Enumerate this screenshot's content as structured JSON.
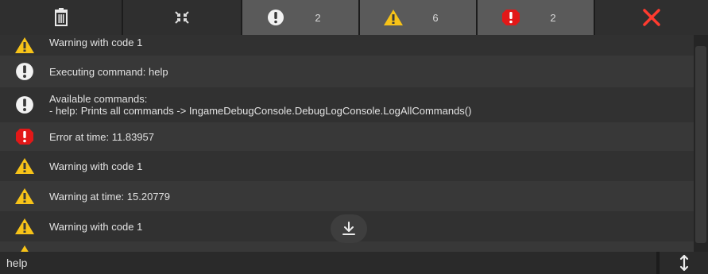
{
  "toolbar": {
    "clear_icon": "trash-icon",
    "collapse_icon": "collapse-icon",
    "filters": [
      {
        "type": "info",
        "icon": "info-icon",
        "count": "2"
      },
      {
        "type": "warning",
        "icon": "warning-icon",
        "count": "6"
      },
      {
        "type": "error",
        "icon": "error-icon",
        "count": "2"
      }
    ],
    "close_icon": "close-icon",
    "colors": {
      "info": "#f2f2f2",
      "warning": "#f7c318",
      "error": "#e21818",
      "close": "#ff3b2f"
    }
  },
  "logs": [
    {
      "type": "warning",
      "text": "Warning with code 1"
    },
    {
      "type": "info",
      "text": "Executing command: help"
    },
    {
      "type": "info",
      "text": "Available commands:\n- help: Prints all commands -> IngameDebugConsole.DebugLogConsole.LogAllCommands()"
    },
    {
      "type": "error",
      "text": "Error at time: 11.83957"
    },
    {
      "type": "warning",
      "text": "Warning with code 1"
    },
    {
      "type": "warning",
      "text": "Warning at time: 15.20779"
    },
    {
      "type": "warning",
      "text": "Warning with code 1"
    },
    {
      "type": "warning",
      "text": ""
    }
  ],
  "snap_icon": "scroll-to-bottom-icon",
  "command": {
    "value": "help",
    "resize_icon": "resize-vertical-icon"
  }
}
